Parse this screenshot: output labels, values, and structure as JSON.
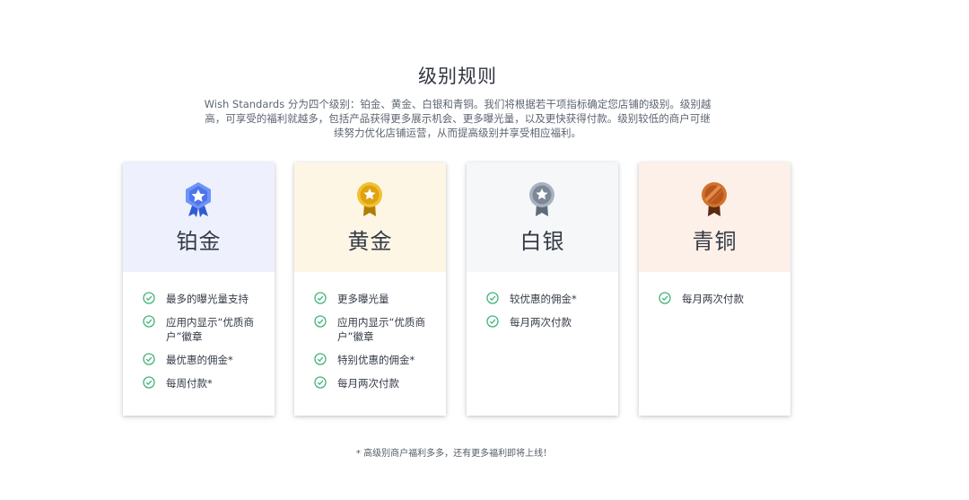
{
  "page": {
    "title": "级别规则",
    "intro": "Wish Standards 分为四个级别：铂金、黄金、白银和青铜。我们将根据若干项指标确定您店铺的级别。级别越高，可享受的福利就越多，包括产品获得更多展示机会、更多曝光量，以及更快获得付款。级别较低的商户可继续努力优化店铺运营，从而提高级别并享受相应福利。",
    "footnote": "* 高级别商户福利多多，还有更多福利即将上线！"
  },
  "tiers": [
    {
      "name": "铂金",
      "medal_icon": "platinum-medal-icon",
      "header_color": "#eef1fd",
      "medal_color": "#5b82f5",
      "benefits": [
        "最多的曝光量支持",
        "应用内显示“优质商户”徽章",
        "最优惠的佣金*",
        "每周付款*"
      ]
    },
    {
      "name": "黄金",
      "medal_icon": "gold-medal-icon",
      "header_color": "#fdf6e5",
      "medal_color": "#e6ab12",
      "benefits": [
        "更多曝光量",
        "应用内显示“优质商户”徽章",
        "特别优惠的佣金*",
        "每月两次付款"
      ]
    },
    {
      "name": "白银",
      "medal_icon": "silver-medal-icon",
      "header_color": "#f6f7f9",
      "medal_color": "#8a95a3",
      "benefits": [
        "较优惠的佣金*",
        "每月两次付款"
      ]
    },
    {
      "name": "青铜",
      "medal_icon": "bronze-medal-icon",
      "header_color": "#fdf0e8",
      "medal_color": "#c8662a",
      "benefits": [
        "每月两次付款"
      ]
    }
  ],
  "colors": {
    "check": "#43b27a"
  }
}
